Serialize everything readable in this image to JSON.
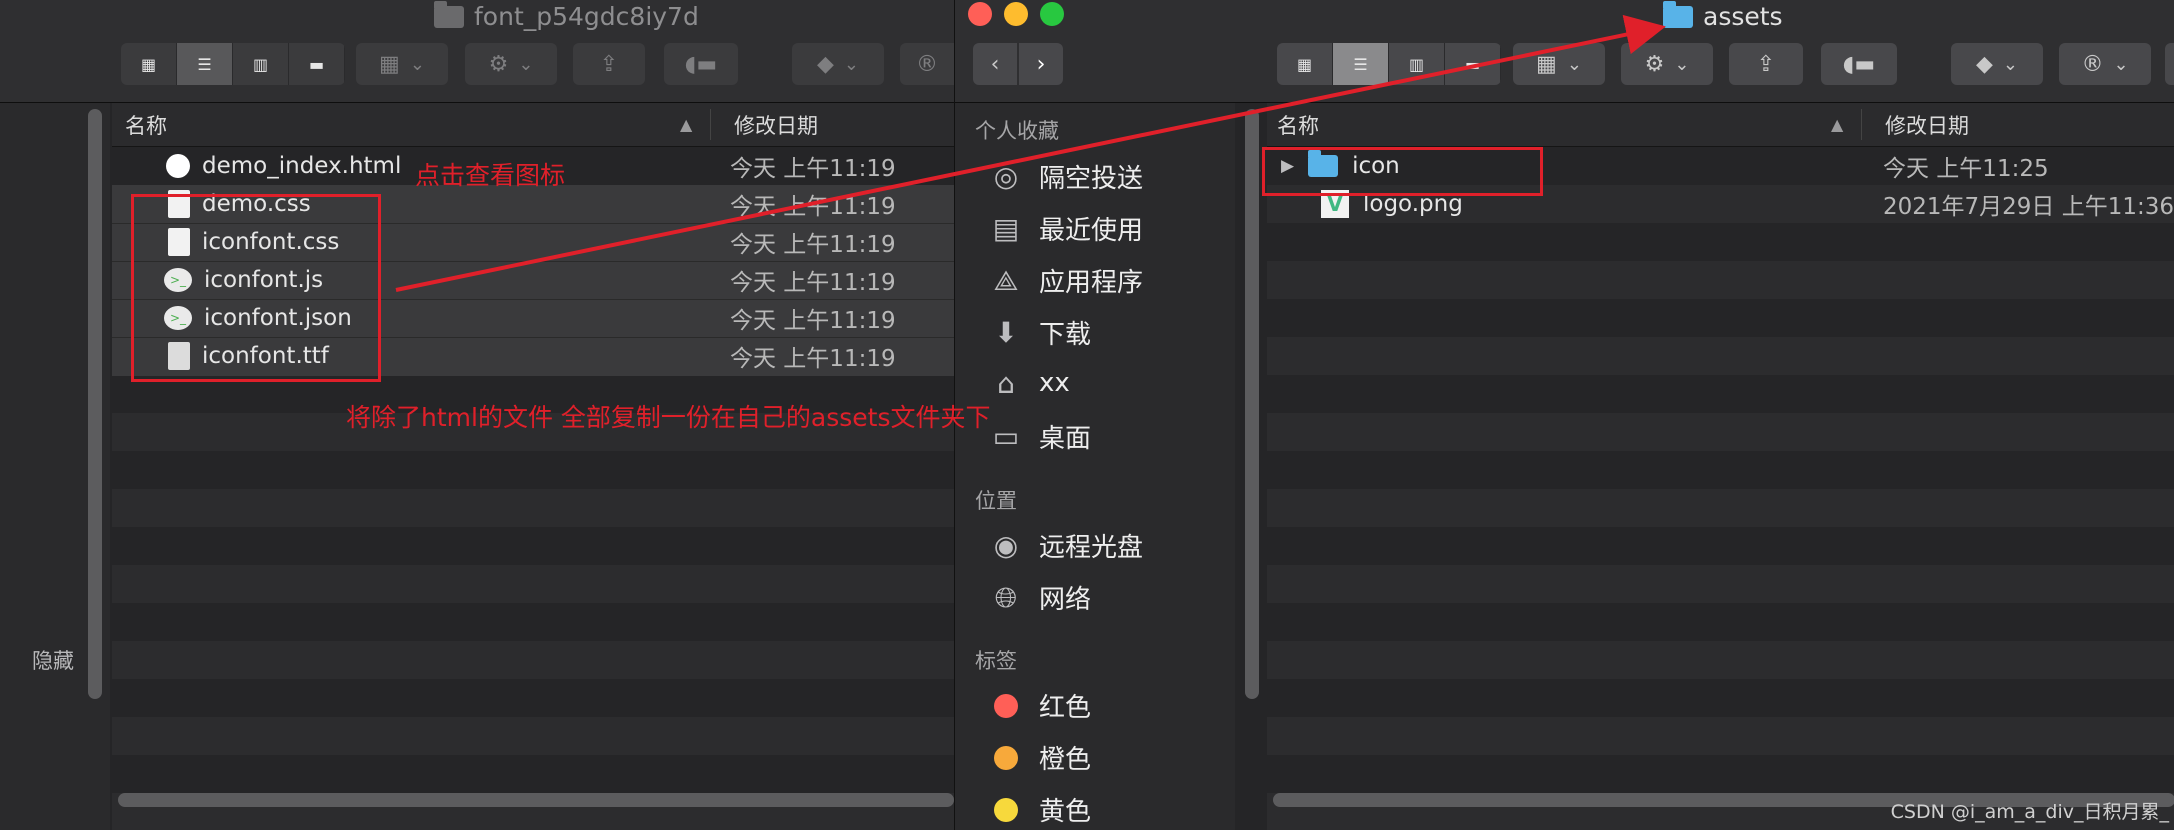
{
  "left": {
    "title": "font_p54gdc8iy7d",
    "sidebar_label": "隐藏",
    "columns": {
      "name": "名称",
      "date": "修改日期"
    },
    "files": [
      {
        "name": "demo_index.html",
        "date": "今天 上午11:19",
        "icon": "chrome-icon"
      },
      {
        "name": "demo.css",
        "date": "今天 上午11:19",
        "icon": "document-icon"
      },
      {
        "name": "iconfont.css",
        "date": "今天 上午11:19",
        "icon": "document-icon"
      },
      {
        "name": "iconfont.js",
        "date": "今天 上午11:19",
        "icon": "wechat-devtools-icon"
      },
      {
        "name": "iconfont.json",
        "date": "今天 上午11:19",
        "icon": "wechat-devtools-icon"
      },
      {
        "name": "iconfont.ttf",
        "date": "今天 上午11:19",
        "icon": "font-file-icon"
      }
    ]
  },
  "right": {
    "title": "assets",
    "columns": {
      "name": "名称",
      "date": "修改日期"
    },
    "files": [
      {
        "name": "icon",
        "date": "今天 上午11:25",
        "icon": "folder-icon"
      },
      {
        "name": "logo.png",
        "date": "2021年7月29日 上午11:36",
        "icon": "vue-logo-icon"
      }
    ],
    "sidebar": {
      "favorites_label": "个人收藏",
      "favorites": [
        {
          "label": "隔空投送",
          "icon": "airdrop-icon"
        },
        {
          "label": "最近使用",
          "icon": "recents-icon"
        },
        {
          "label": "应用程序",
          "icon": "applications-icon"
        },
        {
          "label": "下载",
          "icon": "downloads-icon"
        },
        {
          "label": "xx",
          "icon": "home-icon"
        },
        {
          "label": "桌面",
          "icon": "desktop-icon"
        }
      ],
      "locations_label": "位置",
      "locations": [
        {
          "label": "远程光盘",
          "icon": "disc-icon"
        },
        {
          "label": "网络",
          "icon": "network-icon"
        }
      ],
      "tags_label": "标签",
      "tags": [
        {
          "label": "红色",
          "color": "#ff5f57"
        },
        {
          "label": "橙色",
          "color": "#f7a93b"
        },
        {
          "label": "黄色",
          "color": "#f7d93c"
        }
      ]
    }
  },
  "annotations": {
    "click_hint": "点击查看图标",
    "copy_hint": "将除了html的文件 全部复制一份在自己的assets文件夹下"
  },
  "colors": {
    "annotation_red": "#e0202a",
    "folder_blue": "#58b3e8"
  },
  "watermark": "CSDN @i_am_a_div_日积月累_"
}
